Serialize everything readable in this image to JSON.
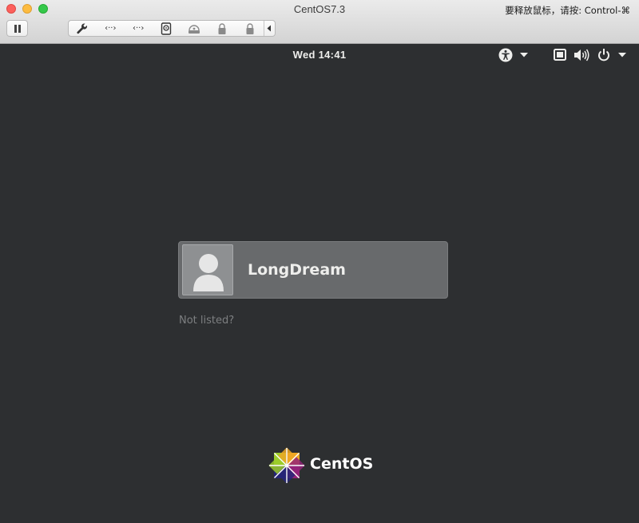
{
  "window": {
    "title": "CentOS7.3",
    "release_hint": "要释放鼠标，请按: Control-⌘"
  },
  "toolbar": {
    "items": [
      {
        "icon": "wrench-icon",
        "glyph": "🔧"
      },
      {
        "icon": "network-adapter-icon",
        "glyph": "‹··›"
      },
      {
        "icon": "network-adapter-2-icon",
        "glyph": "‹··›"
      },
      {
        "icon": "hard-disk-icon",
        "glyph": ""
      },
      {
        "icon": "optical-drive-icon",
        "glyph": ""
      },
      {
        "icon": "usb-lock-icon",
        "glyph": ""
      },
      {
        "icon": "usb-lock-2-icon",
        "glyph": ""
      }
    ],
    "collapse_icon": "triangle-left-icon"
  },
  "gnome_bar": {
    "clock": "Wed 14:41",
    "icons": [
      "accessibility-icon",
      "chevron-down-icon",
      "display-icon",
      "volume-icon",
      "power-icon",
      "chevron-down-icon"
    ]
  },
  "login": {
    "user_name": "LongDream",
    "not_listed": "Not listed?"
  },
  "branding": {
    "name": "CentOS"
  }
}
